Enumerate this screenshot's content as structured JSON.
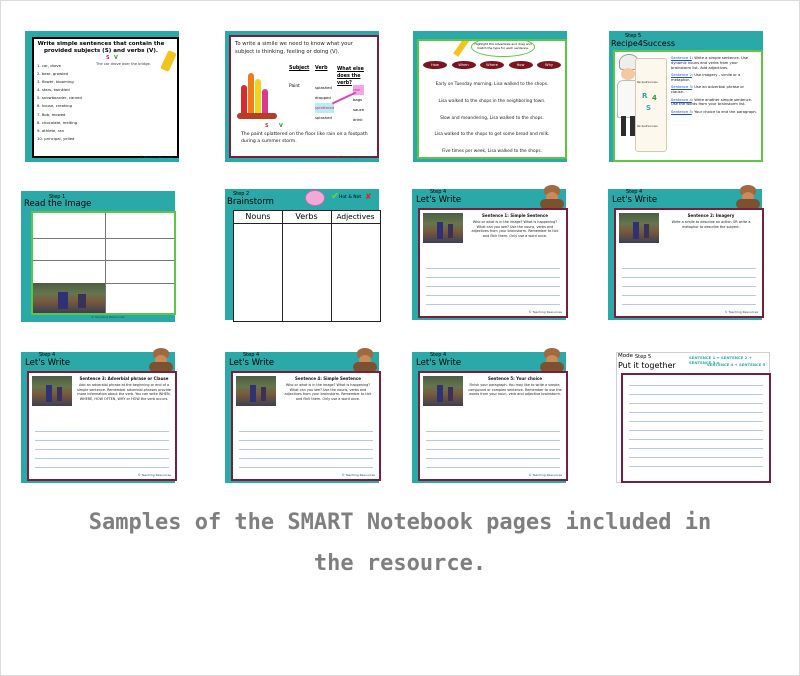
{
  "caption": {
    "line1": "Samples of the SMART Notebook pages included in",
    "line2": "the resource."
  },
  "footer": "© Teaching Resources",
  "slide1": {
    "title": "Write simple sentences that contain the provided subjects (S) and verbs (V).",
    "sv_s": "S",
    "sv_v": "V",
    "example": "The car drove over the bridge.",
    "items": [
      "1. car, drove",
      "2. bear, growled",
      "3. flower, blooming",
      "4. stars, twinkled",
      "5. snowboarder, carved",
      "6. house, creaking",
      "7. Bob, mowed",
      "8. chocolate, melting",
      "9. athlete, ran",
      "10. principal, yelled"
    ]
  },
  "slide2": {
    "title": "To write a simile we need to know what your subject is thinking, feeling or doing (V).",
    "headers": [
      "Subject",
      "Verb",
      "What else does the verb?"
    ],
    "subject": "Paint",
    "verbs": [
      "splashed",
      "dropped",
      "splattered",
      "sploshed"
    ],
    "others": [
      "rain",
      "bags",
      "sauce",
      "drink"
    ],
    "sv_s": "S",
    "sv_v": "V",
    "sentence": "The paint splattered on the floor like rain on a footpath during a summer storm."
  },
  "slide3": {
    "bubble": "Highlight the adverbials and drag and match the type for each sentence.",
    "pills": [
      "How",
      "When",
      "Where",
      "How",
      "Why"
    ],
    "sentences": [
      "Early on Tuesday morning, Lisa walked to the shops.",
      "Lisa walked to the shops in the neighboring town.",
      "Slow and meandering, Lisa walked to the shops.",
      "Lisa walked to the shops to get some bread and milk.",
      "Five times per week, Lisa walked to the shops."
    ]
  },
  "slide4": {
    "step": "Step 5",
    "title": "Recipe4Success",
    "scroll_top": "Recipe4Success",
    "scroll_r": "R",
    "scroll_4": "4",
    "scroll_s": "S",
    "scroll_bottom": "Recipe4Success",
    "lines": [
      {
        "label": "Sentence 1",
        "text": ": Write a simple sentence. Use dynamic nouns and verbs from your brainstorm list. Add adjectives."
      },
      {
        "label": "Sentence 2",
        "text": ": Use imagery - simile or a metaphor."
      },
      {
        "label": "Sentence 3",
        "text": ": Use an adverbial phrase or clause."
      },
      {
        "label": "Sentence 4",
        "text": ": Write another simple sentence. Use the words from your brainstorm list."
      },
      {
        "label": "Sentence 5",
        "text": ": Your choice to end the paragraph."
      }
    ]
  },
  "slide5": {
    "step": "Step 1",
    "title": "Read the Image"
  },
  "slide6": {
    "step": "Step 2",
    "title": "Brainstorm",
    "hotnot": "Hot & Not",
    "cols": [
      "Nouns",
      "Verbs",
      "Adjectives"
    ]
  },
  "slide7": {
    "step": "Step 4",
    "title": "Let's Write",
    "head": "Sentence 1: Simple Sentence",
    "body": "Who or what is in the image? What is happening? What can you see? Use the nouns, verbs and adjectives from your brainstorm. Remember to tick and flick them. Only use a word once."
  },
  "slide8": {
    "step": "Step 4",
    "title": "Let's Write",
    "head": "Sentence 2: Imagery",
    "body": "Write a simile to describe an action OR write a metaphor to describe the subject."
  },
  "slide9": {
    "step": "Step 4",
    "title": "Let's Write",
    "head": "Sentence 3: Adverbial phrase or Clause",
    "body": "Add an adverbial phrase at the beginning or end of a simple sentence. Remember adverbial phrases provide more information about the verb. You can write WHEN, WHERE, HOW OFTEN, WHY or HOW the verb occurs."
  },
  "slide10": {
    "step": "Step 4",
    "title": "Let's Write",
    "head": "Sentence 4: Simple Sentence",
    "body": "Who or what is in the image? What is happening? What can you see? Use the nouns, verbs and adjectives from your brainstorm. Remember to tick and flick them. Only use a word once."
  },
  "slide11": {
    "step": "Step 4",
    "title": "Let's Write",
    "head": "Sentence 5: Your choice",
    "body": "Finish your paragraph. You may like to write a simple, compound or complex sentence. Remember to use the words from your noun, verb and adjective brainstorm."
  },
  "slide12": {
    "mode": "Mode",
    "step": "Step 5",
    "title": "Put it together",
    "formula1": "SENTENCE 1 + SENTENCE 2 + SENTENCE 3 +",
    "formula2": "SENTENCE 4 + SENTENCE 5"
  },
  "colors": {
    "teal": "#2aa9a8",
    "card_border_green": "#5fc544",
    "card_border_purple": "#7a1f3a",
    "highlight_red": "#e0234a",
    "highlight_pink": "#e040c0",
    "caption": "#7f7f7f"
  }
}
